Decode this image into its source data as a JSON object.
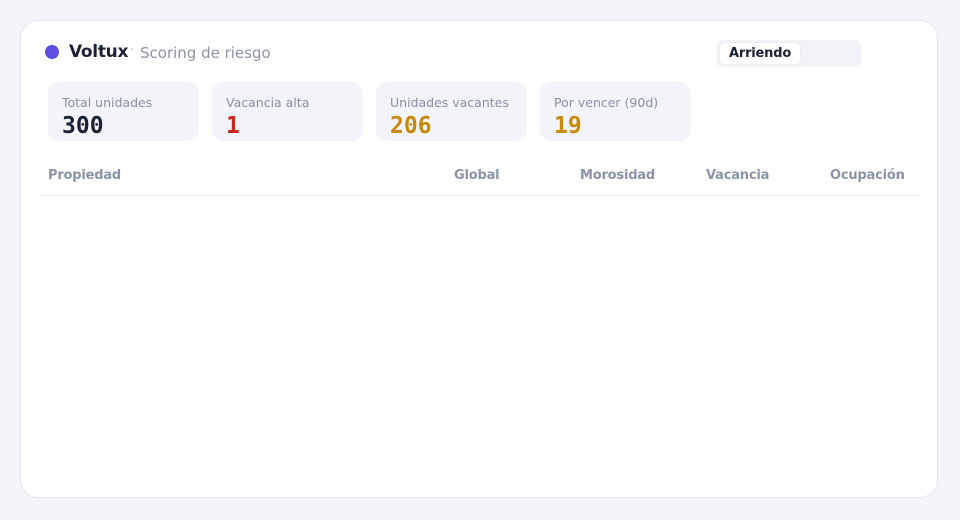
{
  "header": {
    "brand": "Voltux",
    "separator": "·",
    "subtitle": "Scoring de riesgo",
    "brand_color": "#5b4fe0"
  },
  "segmented": {
    "active_label": "Arriendo"
  },
  "kpis": [
    {
      "label": "Total unidades",
      "value": "300",
      "color": "#1a2236"
    },
    {
      "label": "Vacancia alta",
      "value": "1",
      "color": "#c5281c"
    },
    {
      "label": "Unidades vacantes",
      "value": "206",
      "color": "#c98a0c"
    },
    {
      "label": "Por vencer (90d)",
      "value": "19",
      "color": "#c98a0c"
    }
  ],
  "table": {
    "columns": [
      "Propiedad",
      "Global",
      "Morosidad",
      "Vacancia",
      "Ocupación"
    ],
    "rows": []
  }
}
